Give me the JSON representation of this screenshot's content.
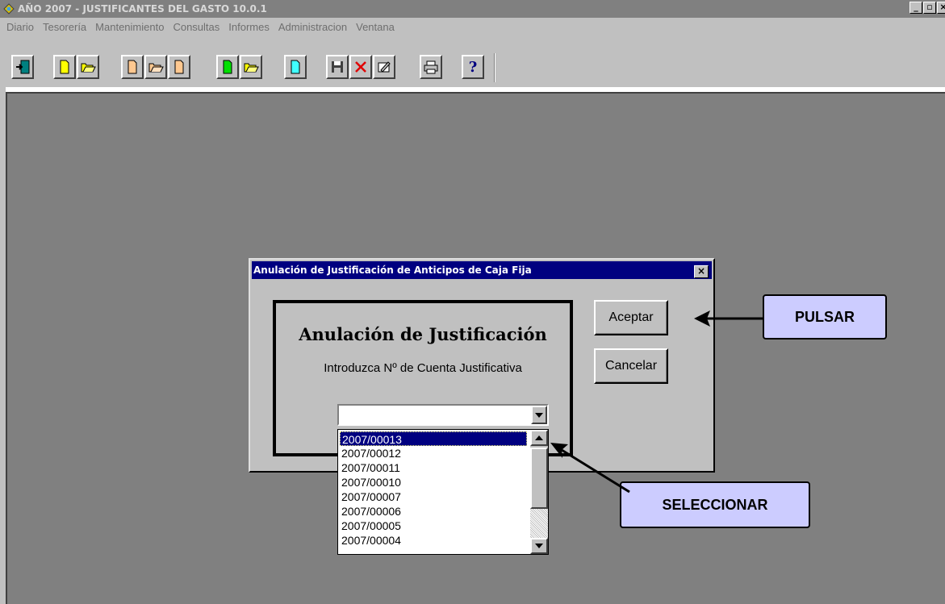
{
  "window": {
    "title": "AÑO 2007 - JUSTIFICANTES DEL GASTO 10.0.1",
    "controls": [
      "_",
      "▫",
      "×"
    ]
  },
  "menubar": {
    "items": [
      "Diario",
      "Tesorería",
      "Mantenimiento",
      "Consultas",
      "Informes",
      "Administracion",
      "Ventana"
    ]
  },
  "toolbar": {
    "buttons": [
      "exit-icon",
      "new-document-icon",
      "open-folder-icon",
      "new-document-icon",
      "open-folder-icon",
      "document-icon",
      "new-green-document-icon",
      "open-folder-icon",
      "document-icon",
      "save-icon",
      "delete-icon",
      "edit-icon",
      "print-icon",
      "help-icon"
    ],
    "help_label": "?"
  },
  "dialog": {
    "title": "Anulación de Justificación de Anticipos de Caja Fija",
    "close_label": "×",
    "heading": "Anulación de Justificación",
    "instruction": "Introduzca Nº de Cuenta Justificativa",
    "accept_label": "Aceptar",
    "cancel_label": "Cancelar",
    "combo_value": "",
    "list_items": [
      "2007/00013",
      "2007/00012",
      "2007/00011",
      "2007/00010",
      "2007/00007",
      "2007/00006",
      "2007/00005",
      "2007/00004"
    ],
    "selected_index": 0
  },
  "annotations": {
    "pulsar": "PULSAR",
    "seleccionar": "SELECCIONAR"
  },
  "colors": {
    "title_active": "#000080",
    "callout_fill": "#ccccff",
    "workspace": "#808080",
    "face": "#c0c0c0"
  }
}
